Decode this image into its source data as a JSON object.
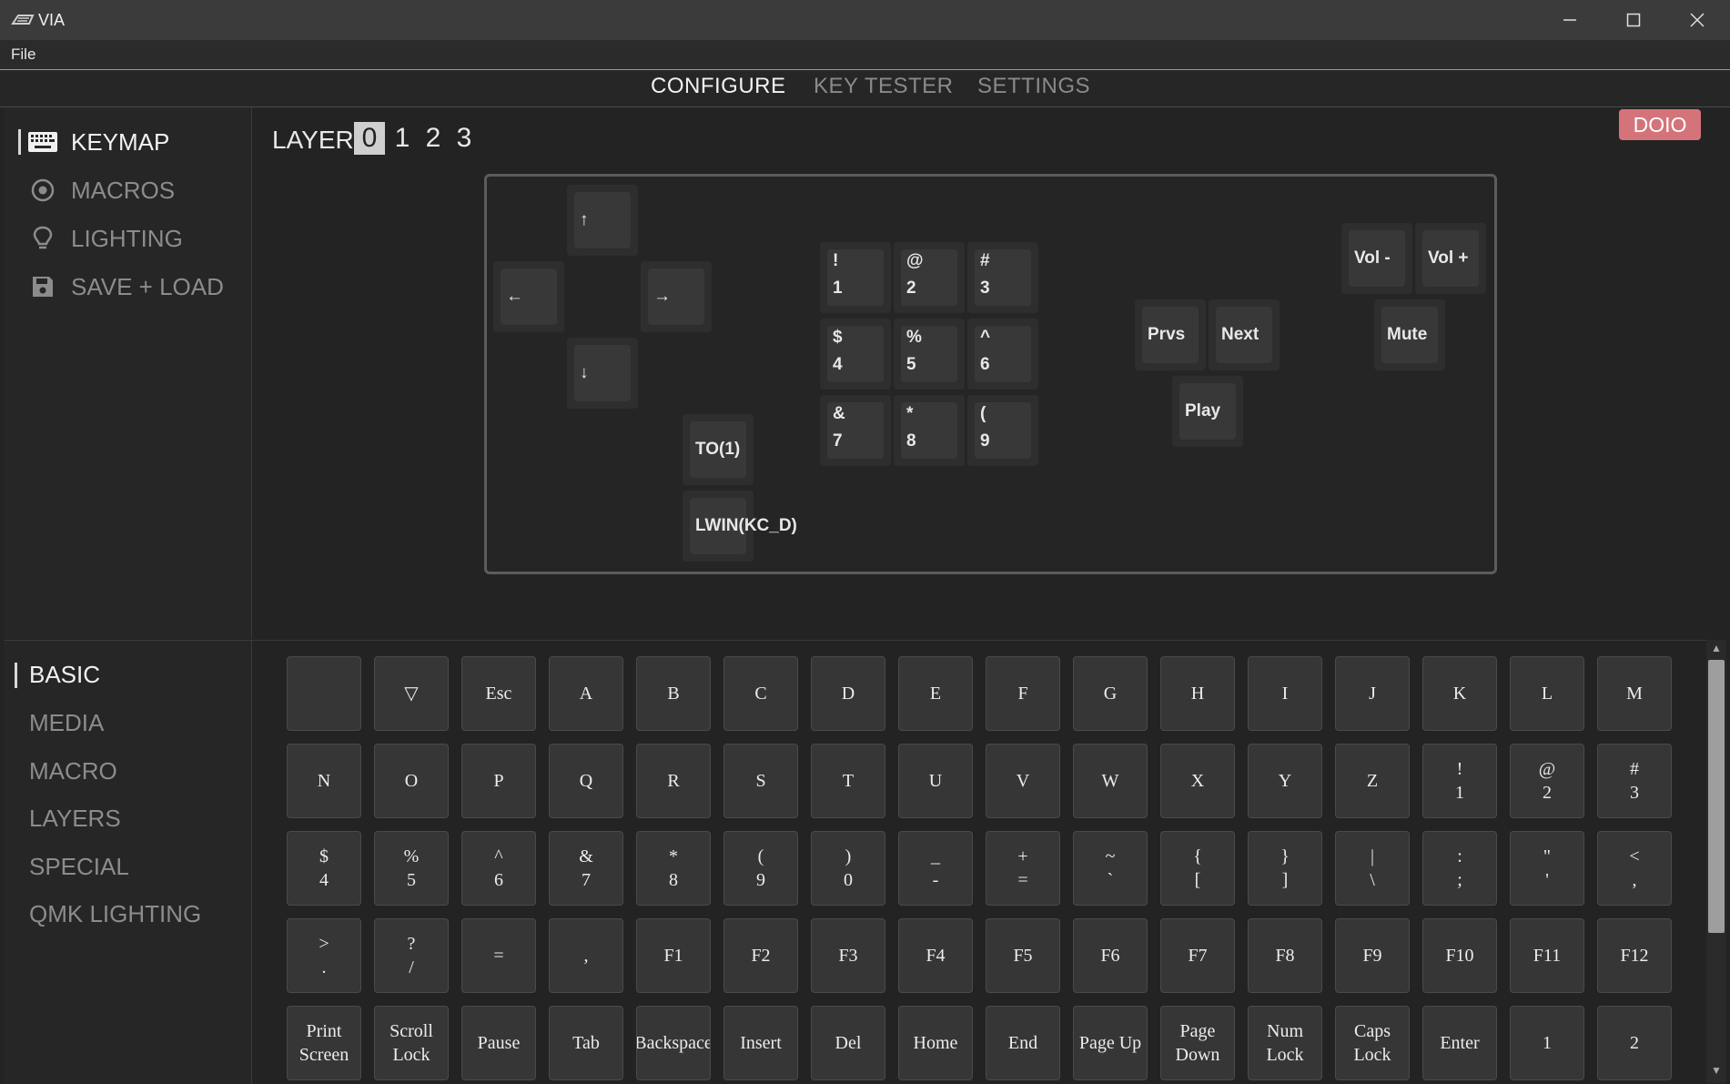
{
  "window": {
    "title": "VIA"
  },
  "menu": {
    "file": "File"
  },
  "topnav": [
    "CONFIGURE",
    "KEY TESTER",
    "SETTINGS"
  ],
  "sidebar": [
    "KEYMAP",
    "MACROS",
    "LIGHTING",
    "SAVE + LOAD"
  ],
  "layer": {
    "label": "LAYER",
    "numbers": [
      "0",
      "1",
      "2",
      "3"
    ],
    "active": "0"
  },
  "badge": "DOIO",
  "keyboard": {
    "up": "↑",
    "left": "←",
    "right": "→",
    "down": "↓",
    "to1": "TO(1)",
    "lwin": "LWIN(KC_D)",
    "n1": [
      "!",
      "1"
    ],
    "n2": [
      "@",
      "2"
    ],
    "n3": [
      "#",
      "3"
    ],
    "n4": [
      "$",
      "4"
    ],
    "n5": [
      "%",
      "5"
    ],
    "n6": [
      "^",
      "6"
    ],
    "n7": [
      "&",
      "7"
    ],
    "n8": [
      "*",
      "8"
    ],
    "n9": [
      "(",
      "9"
    ],
    "prvs": "Prvs",
    "next": "Next",
    "play": "Play",
    "voldown": "Vol -",
    "volup": "Vol +",
    "mute": "Mute"
  },
  "categories": [
    "BASIC",
    "MEDIA",
    "MACRO",
    "LAYERS",
    "SPECIAL",
    "QMK LIGHTING"
  ],
  "keys": [
    [
      [
        ""
      ],
      [
        "▽"
      ],
      [
        "Esc"
      ],
      [
        "A"
      ],
      [
        "B"
      ],
      [
        "C"
      ],
      [
        "D"
      ],
      [
        "E"
      ],
      [
        "F"
      ],
      [
        "G"
      ],
      [
        "H"
      ],
      [
        "I"
      ],
      [
        "J"
      ],
      [
        "K"
      ],
      [
        "L"
      ],
      [
        "M"
      ]
    ],
    [
      [
        "N"
      ],
      [
        "O"
      ],
      [
        "P"
      ],
      [
        "Q"
      ],
      [
        "R"
      ],
      [
        "S"
      ],
      [
        "T"
      ],
      [
        "U"
      ],
      [
        "V"
      ],
      [
        "W"
      ],
      [
        "X"
      ],
      [
        "Y"
      ],
      [
        "Z"
      ],
      [
        "!",
        "1"
      ],
      [
        "@",
        "2"
      ],
      [
        "#",
        "3"
      ]
    ],
    [
      [
        "$",
        "4"
      ],
      [
        "%",
        "5"
      ],
      [
        "^",
        "6"
      ],
      [
        "&",
        "7"
      ],
      [
        "*",
        "8"
      ],
      [
        "(",
        "9"
      ],
      [
        ")",
        "0"
      ],
      [
        "_",
        "-"
      ],
      [
        "+",
        "="
      ],
      [
        "~",
        "`"
      ],
      [
        "{",
        "["
      ],
      [
        "}",
        "]"
      ],
      [
        "|",
        "\\"
      ],
      [
        ":",
        ";"
      ],
      [
        "\"",
        "'"
      ],
      [
        "<",
        ","
      ]
    ],
    [
      [
        ">",
        "."
      ],
      [
        "?",
        "/"
      ],
      [
        "="
      ],
      [
        ","
      ],
      [
        "F1"
      ],
      [
        "F2"
      ],
      [
        "F3"
      ],
      [
        "F4"
      ],
      [
        "F5"
      ],
      [
        "F6"
      ],
      [
        "F7"
      ],
      [
        "F8"
      ],
      [
        "F9"
      ],
      [
        "F10"
      ],
      [
        "F11"
      ],
      [
        "F12"
      ]
    ],
    [
      [
        "Print",
        "Screen"
      ],
      [
        "Scroll",
        "Lock"
      ],
      [
        "Pause"
      ],
      [
        "Tab"
      ],
      [
        "Backspace"
      ],
      [
        "Insert"
      ],
      [
        "Del"
      ],
      [
        "Home"
      ],
      [
        "End"
      ],
      [
        "Page Up"
      ],
      [
        "Page",
        "Down"
      ],
      [
        "Num",
        "Lock"
      ],
      [
        "Caps",
        "Lock"
      ],
      [
        "Enter"
      ],
      [
        "1"
      ],
      [
        "2"
      ]
    ]
  ]
}
